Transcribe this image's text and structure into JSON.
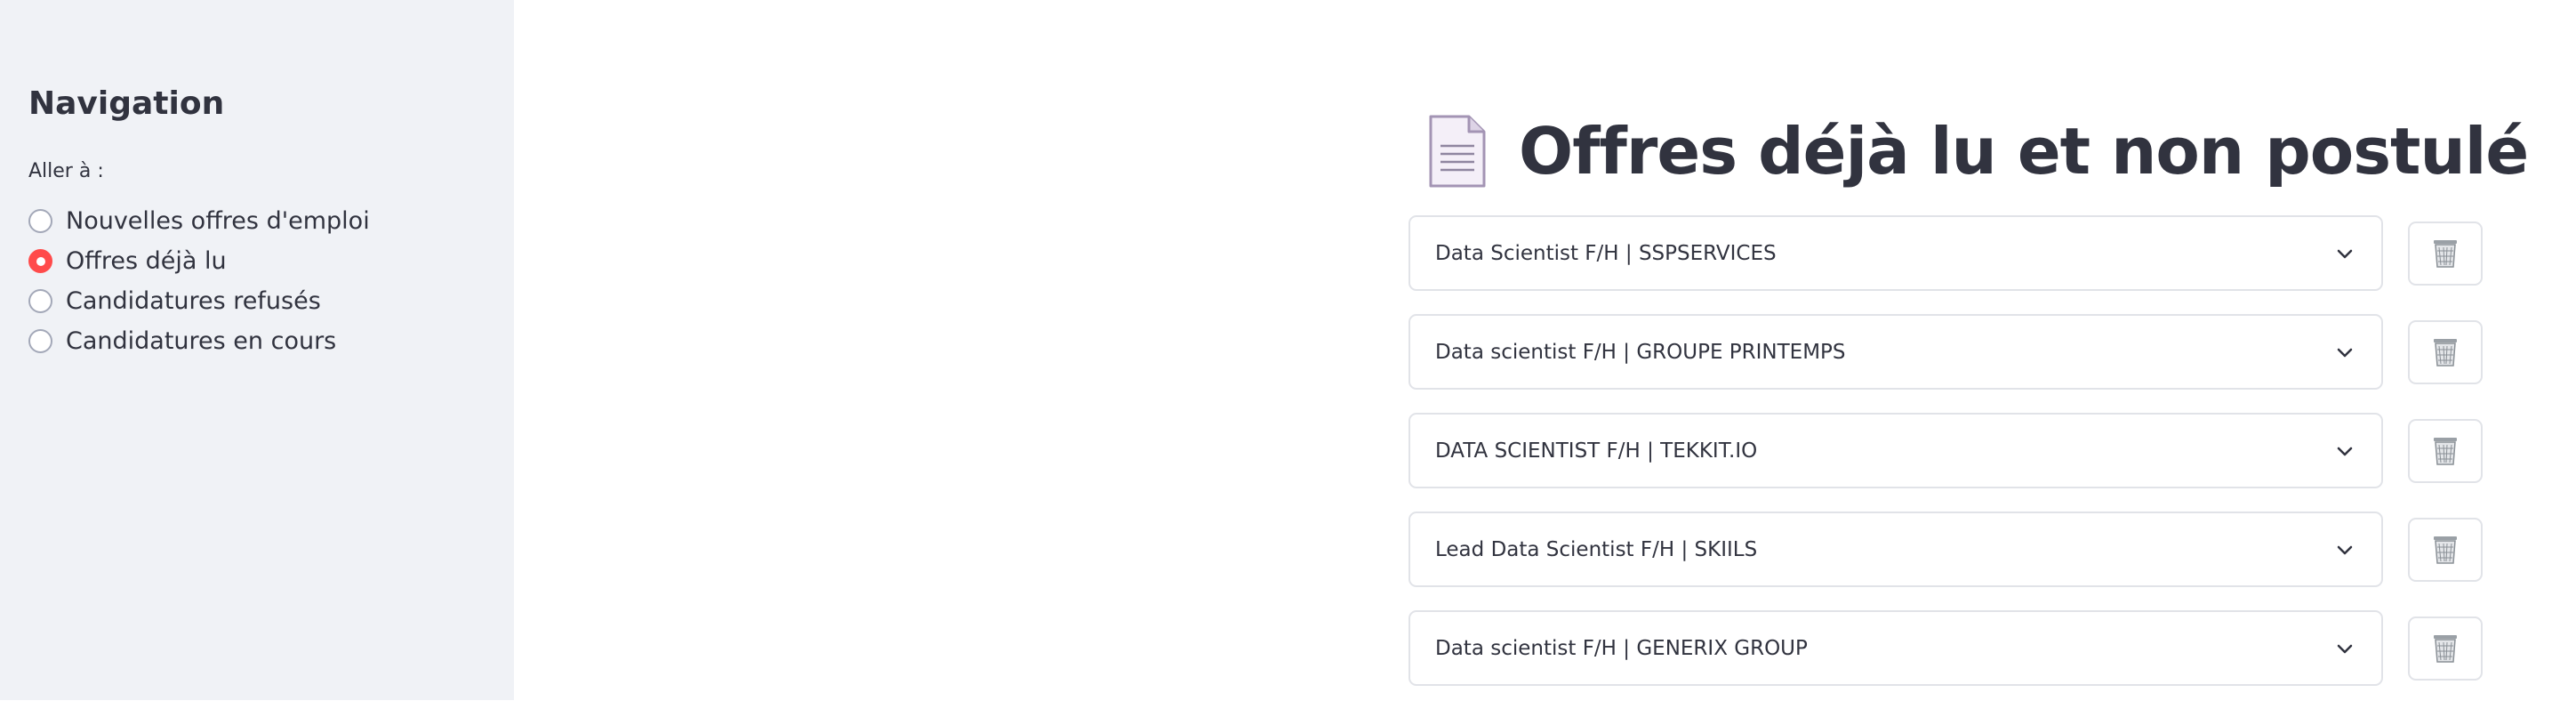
{
  "sidebar": {
    "title": "Navigation",
    "radio_label": "Aller à :",
    "options": [
      {
        "label": "Nouvelles offres d'emploi",
        "selected": false
      },
      {
        "label": "Offres déjà lu",
        "selected": true
      },
      {
        "label": "Candidatures refusés",
        "selected": false
      },
      {
        "label": "Candidatures en cours",
        "selected": false
      }
    ],
    "selected_color": "#ff4b4b"
  },
  "main": {
    "title": "Offres déjà lu et non postulé",
    "title_icon": "page-facing-up-icon",
    "offers": [
      {
        "label": "Data Scientist F/H | SSPSERVICES"
      },
      {
        "label": "Data scientist F/H | GROUPE PRINTEMPS"
      },
      {
        "label": "DATA SCIENTIST F/H | TEKKIT.IO"
      },
      {
        "label": "Lead Data Scientist F/H | SKIILS"
      },
      {
        "label": "Data scientist F/H | GENERIX GROUP"
      }
    ],
    "offer_icon": "chevron-down-icon",
    "delete_icon": "wastebasket-icon"
  }
}
